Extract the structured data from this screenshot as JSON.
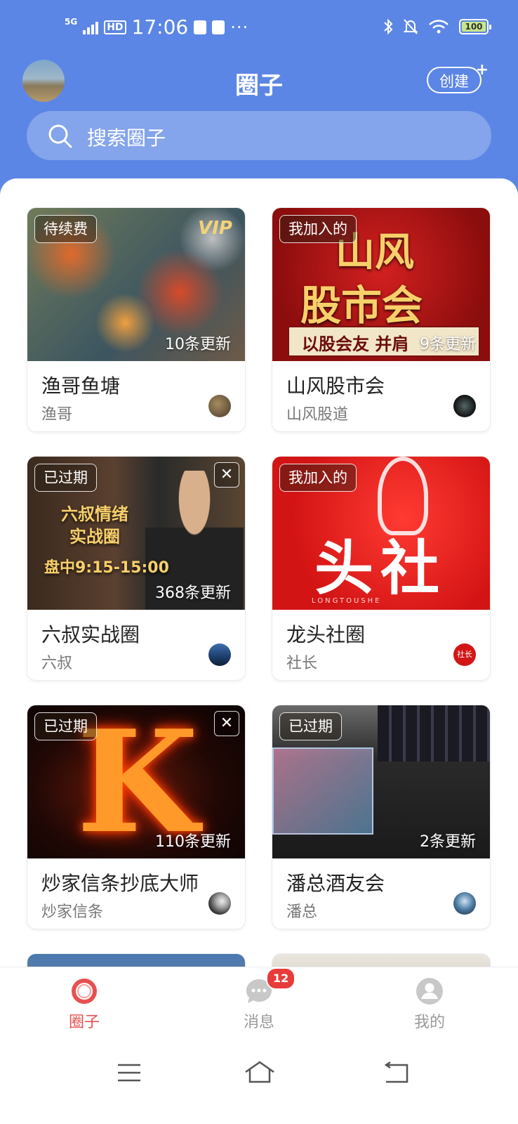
{
  "status_bar": {
    "network": "5G",
    "hd": "HD",
    "time": "17:06",
    "more": "···",
    "battery": "100"
  },
  "header": {
    "title": "圈子",
    "create_label": "创建",
    "create_plus": "+"
  },
  "search": {
    "placeholder": "搜索圈子"
  },
  "circles": [
    {
      "tag": "待续费",
      "name": "渔哥鱼塘",
      "owner": "渔哥",
      "updates": "10条更新",
      "badge_text": "VIP"
    },
    {
      "tag": "我加入的",
      "name": "山风股市会",
      "owner": "山风股道",
      "updates": "9条更新",
      "image_text": [
        "山风",
        "股市会",
        "以股会友 并肩"
      ]
    },
    {
      "tag": "已过期",
      "name": "六叔实战圈",
      "owner": "六叔",
      "updates": "368条更新",
      "image_text": [
        "六叔情绪",
        "实战圈",
        "盘中9:15-15:00"
      ]
    },
    {
      "tag": "我加入的",
      "name": "龙头社圈",
      "owner": "社长",
      "updates": "",
      "image_text": [
        "头社",
        "LONGTOUSHE"
      ],
      "owner_avatar_text": "社长"
    },
    {
      "tag": "已过期",
      "name": "炒家信条抄底大师",
      "owner": "炒家信条",
      "updates": "110条更新",
      "image_text": [
        "K"
      ]
    },
    {
      "tag": "已过期",
      "name": "潘总酒友会",
      "owner": "潘总",
      "updates": "2条更新"
    }
  ],
  "tabs": [
    {
      "label": "圈子",
      "active": true
    },
    {
      "label": "消息",
      "badge": "12"
    },
    {
      "label": "我的"
    }
  ],
  "colors": {
    "primary": "#5b86e5",
    "accent": "#e85050",
    "badge": "#e83b3b"
  }
}
